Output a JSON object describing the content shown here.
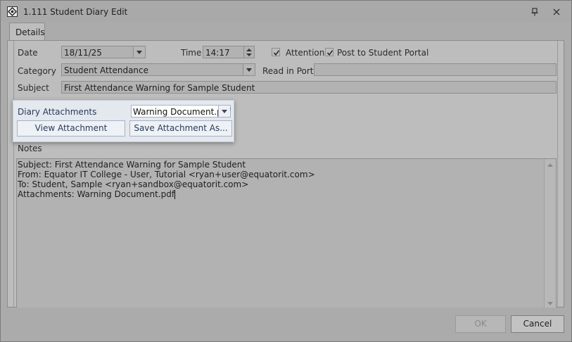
{
  "window": {
    "title": "1.111 Student Diary Edit",
    "icons": {
      "app": "app-logo-icon",
      "pin": "pin-icon",
      "close": "close-icon"
    }
  },
  "tabs": [
    {
      "label": "Details"
    }
  ],
  "form": {
    "date_label": "Date",
    "date_value": "18/11/25",
    "time_label": "Time",
    "time_value": "14:17",
    "attention_label": "Attention",
    "attention_checked": true,
    "post_portal_label": "Post to Student Portal",
    "post_portal_checked": true,
    "category_label": "Category",
    "category_value": "Student Attendance",
    "read_portal_label": "Read in Portal",
    "read_portal_value": "",
    "subject_label": "Subject",
    "subject_value": "First Attendance Warning for Sample Student",
    "notes_label": "Notes"
  },
  "attachments": {
    "label": "Diary Attachments",
    "selected": "Warning Document.pdf",
    "view_label": "View Attachment",
    "save_label": "Save Attachment As..."
  },
  "notes": {
    "lines": [
      "Subject: First Attendance Warning for Sample Student",
      "From: Equator IT College - User, Tutorial <ryan+user@equatorit.com>",
      "To: Student, Sample <ryan+sandbox@equatorit.com>",
      "Attachments: Warning Document.pdf"
    ]
  },
  "footer": {
    "ok_label": "OK",
    "cancel_label": "Cancel"
  }
}
